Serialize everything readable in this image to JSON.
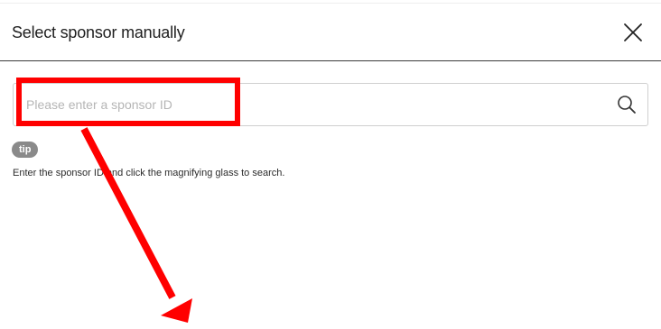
{
  "dialog": {
    "title": "Select sponsor manually",
    "close_icon": "close-icon"
  },
  "search": {
    "value": "",
    "placeholder": "Please enter a sponsor ID",
    "search_icon": "magnifying-glass-icon"
  },
  "tip": {
    "badge_label": "tip",
    "text": "Enter the sponsor ID and click the magnifying glass to search."
  },
  "colors": {
    "annotation": "#ff0000",
    "badge_bg": "#8a8a8a",
    "divider": "#3a3a3a"
  }
}
